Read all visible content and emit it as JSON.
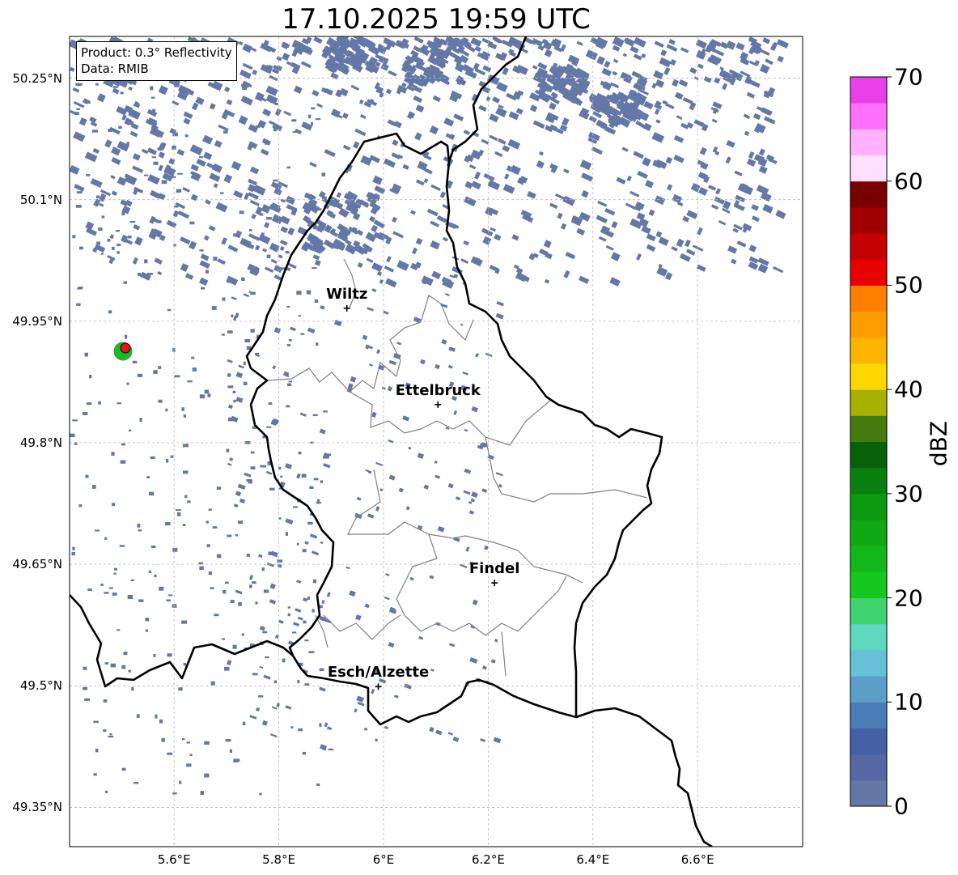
{
  "title": "17.10.2025 19:59 UTC",
  "info_box": {
    "product": "Product: 0.3° Reflectivity",
    "data": "Data: RMIB"
  },
  "map": {
    "lon_range": [
      5.4,
      6.8
    ],
    "lat_range": [
      49.3,
      50.3
    ],
    "lat_ticks": [
      {
        "value": 50.25,
        "label": "50.25°N"
      },
      {
        "value": 50.1,
        "label": "50.1°N"
      },
      {
        "value": 49.95,
        "label": "49.95°N"
      },
      {
        "value": 49.8,
        "label": "49.8°N"
      },
      {
        "value": 49.65,
        "label": "49.65°N"
      },
      {
        "value": 49.5,
        "label": "49.5°N"
      },
      {
        "value": 49.35,
        "label": "49.35°N"
      }
    ],
    "lon_ticks": [
      {
        "value": 5.6,
        "label": "5.6°E"
      },
      {
        "value": 5.8,
        "label": "5.8°E"
      },
      {
        "value": 6.0,
        "label": "6°E"
      },
      {
        "value": 6.2,
        "label": "6.2°E"
      },
      {
        "value": 6.4,
        "label": "6.4°E"
      },
      {
        "value": 6.6,
        "label": "6.6°E"
      }
    ],
    "grid": true,
    "cities": [
      {
        "name": "Wiltz",
        "lon": 5.93,
        "lat": 49.966
      },
      {
        "name": "Ettelbruck",
        "lon": 6.104,
        "lat": 49.847
      },
      {
        "name": "Findel",
        "lon": 6.212,
        "lat": 49.627
      },
      {
        "name": "Esch/Alzette",
        "lon": 5.99,
        "lat": 49.499
      }
    ],
    "radar_site": {
      "lon": 5.505,
      "lat": 49.914,
      "color": "#e8141a"
    },
    "border_color": "#000000",
    "canton_color": "#808080",
    "echo_color": "#6478a8"
  },
  "colorbar": {
    "label": "dBZ",
    "min": 0,
    "max": 70,
    "tick_values": [
      0,
      10,
      20,
      30,
      40,
      50,
      60,
      70
    ],
    "tick_labels": [
      "0",
      "10",
      "20",
      "30",
      "40",
      "50",
      "60",
      "70"
    ],
    "colors": [
      "#6478a8",
      "#5568a3",
      "#4560a4",
      "#4a7db5",
      "#5b9fc8",
      "#66c0d8",
      "#5fd8c0",
      "#40d470",
      "#14c81e",
      "#12b81a",
      "#10a814",
      "#0c9a10",
      "#0a8010",
      "#086008",
      "#447a10",
      "#a8b000",
      "#ffd700",
      "#ffb400",
      "#ff9c00",
      "#ff8000",
      "#e60000",
      "#c40000",
      "#a00000",
      "#780000",
      "#ffe0ff",
      "#ffb0ff",
      "#ff70ff",
      "#e840e8"
    ]
  }
}
